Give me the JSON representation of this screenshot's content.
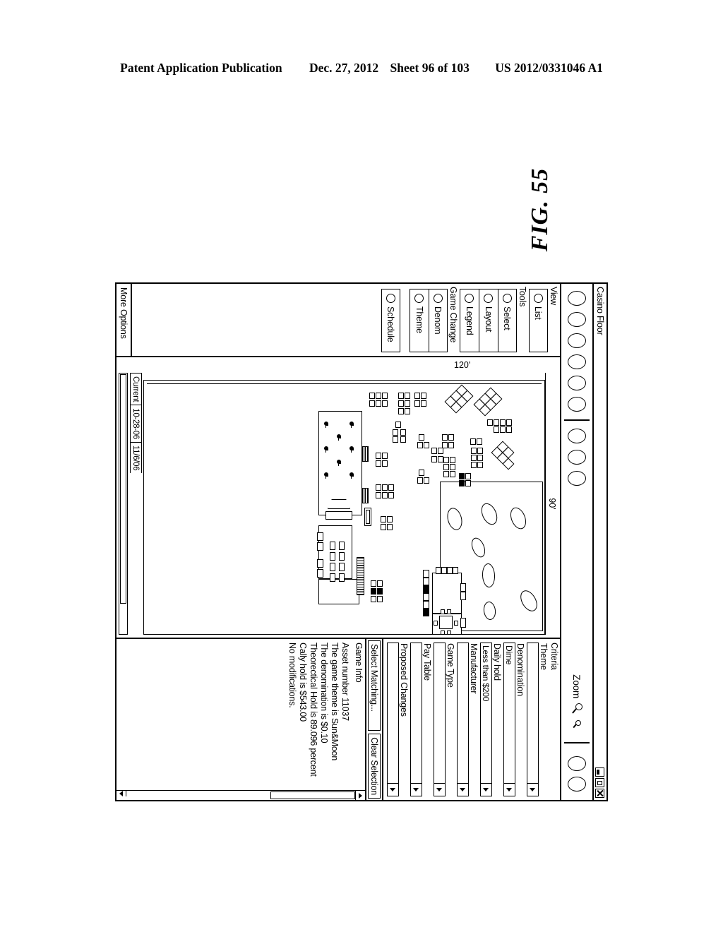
{
  "patent_header": {
    "publication": "Patent Application Publication",
    "date": "Dec. 27, 2012",
    "sheet": "Sheet 96 of 103",
    "number": "US 2012/0331046 A1"
  },
  "figure": {
    "label": "FIG. 55"
  },
  "window": {
    "title": "Casino Floor",
    "controls": [
      "minimize-button",
      "maximize-button",
      "close-button"
    ]
  },
  "toolbar": {
    "left_buttons": [
      "btn-1",
      "btn-2",
      "btn-3",
      "btn-4",
      "btn-5",
      "btn-6"
    ],
    "mid_buttons": [
      "btn-7",
      "btn-8",
      "btn-9"
    ],
    "zoom_label": "Zoom",
    "zoom_in_icon": "magnifier-icon",
    "zoom_out_icon": "magnifier-small-icon",
    "right_buttons": [
      "btn-10",
      "btn-11"
    ]
  },
  "tools_panel": {
    "view_header": "View",
    "view_items": [
      {
        "label": "List"
      }
    ],
    "tools_header": "Tools",
    "tools_items": [
      {
        "label": "Select"
      },
      {
        "label": "Layout"
      },
      {
        "label": "Legend"
      }
    ],
    "game_change_header": "Game Change",
    "game_change_items": [
      {
        "label": "Denom"
      },
      {
        "label": "Theme"
      }
    ],
    "schedule_items": [
      {
        "label": "Schedule"
      }
    ],
    "more_options": "More Options"
  },
  "map": {
    "width_dim": "90'",
    "height_dim": "120'",
    "tabs": [
      "Current",
      "10-28-06",
      "11/6/06"
    ]
  },
  "criteria": {
    "header": "Criteria",
    "fields": [
      {
        "label": "Theme",
        "value": ""
      },
      {
        "label": "Denomination",
        "value": "Dime"
      },
      {
        "label": "Daily hold",
        "value": "Less than $200"
      },
      {
        "label": "Manufacturer",
        "value": ""
      },
      {
        "label": "Game Type",
        "value": ""
      },
      {
        "label": "Pay Table",
        "value": ""
      },
      {
        "label": "Proposed Changes",
        "value": ""
      }
    ],
    "select_matching_button": "Select Matching...",
    "clear_selection_button": "Clear Selection"
  },
  "game_info": {
    "header": "Game Info",
    "lines": [
      "Asset number 11037",
      "The game theme is Sun&Moon",
      "The denomination is $0.10",
      "Theorectical Hold is 89.096 percent",
      "Cally hold is $543.00",
      "No modifications."
    ]
  }
}
